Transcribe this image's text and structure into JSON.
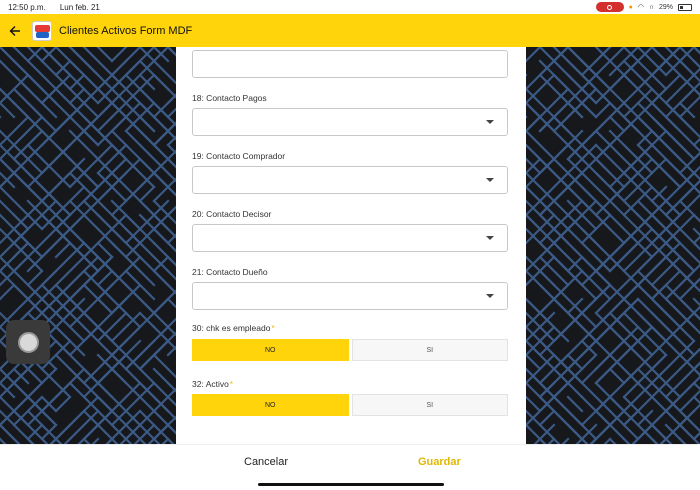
{
  "status_bar": {
    "time": "12:50 p.m.",
    "date": "Lun feb. 21",
    "battery": "29%",
    "battery_level": 0.29
  },
  "app_bar": {
    "title": "Clientes Activos Form MDF",
    "back_icon": "arrow-back-icon",
    "logo_icon": "app-logo-icon"
  },
  "form": {
    "top_field_value": "",
    "fields": [
      {
        "label": "18: Contacto Pagos",
        "value": ""
      },
      {
        "label": "19: Contacto Comprador",
        "value": ""
      },
      {
        "label": "20: Contacto Decisor",
        "value": ""
      },
      {
        "label": "21: Contacto Dueño",
        "value": ""
      }
    ],
    "toggles": [
      {
        "label": "30: chk es empleado",
        "required_mark": "*",
        "options": [
          "NO",
          "SI"
        ],
        "selected": "NO"
      },
      {
        "label": "32: Activo",
        "required_mark": "*",
        "options": [
          "NO",
          "SI"
        ],
        "selected": "NO"
      }
    ]
  },
  "actions": {
    "cancel_label": "Cancelar",
    "save_label": "Guardar"
  },
  "colors": {
    "accent": "#ffd40a",
    "save_text": "#e0b800",
    "pattern_line": "#3b5a86",
    "pattern_bg": "#16181c"
  }
}
